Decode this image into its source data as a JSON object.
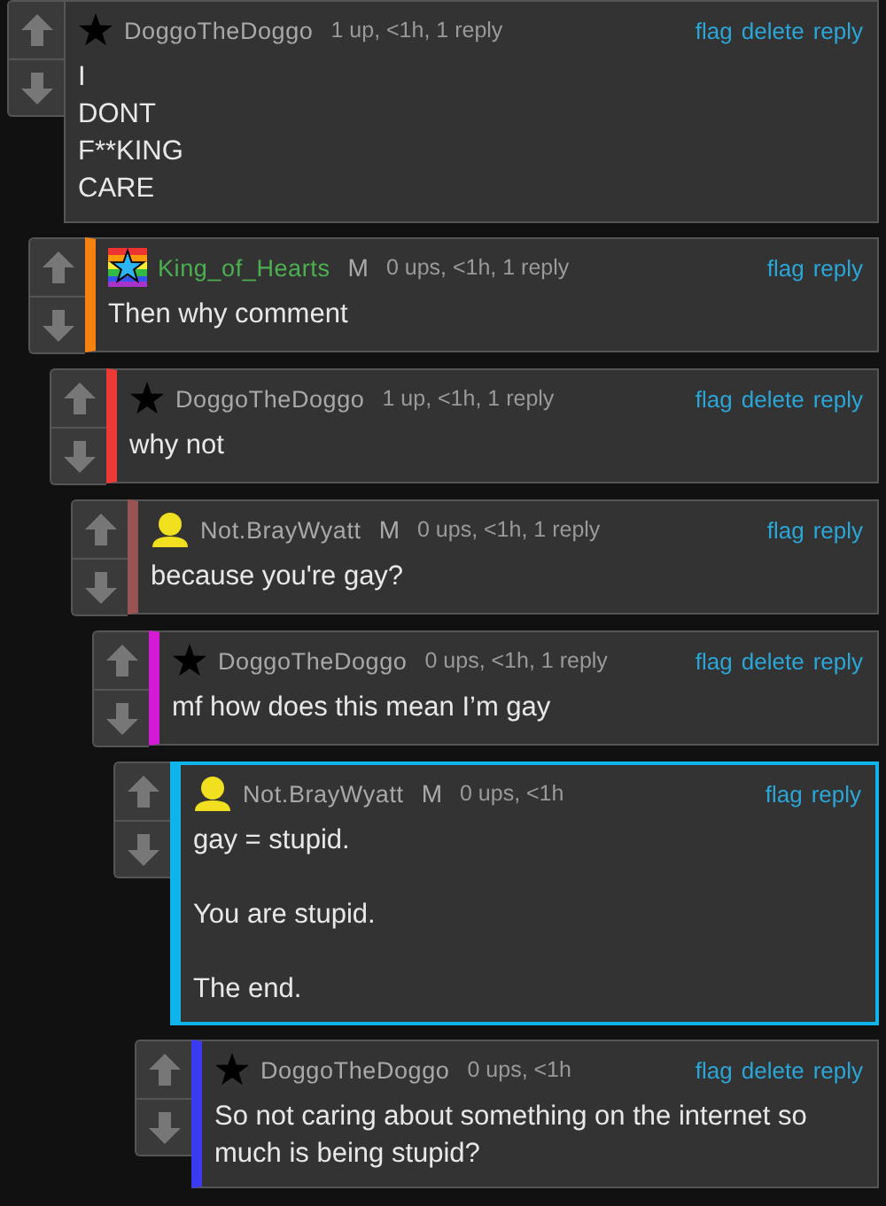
{
  "thread": {
    "author": {
      "name": "DoggoTheDoggo",
      "color": "#a8a8a8"
    },
    "avatar": {
      "kind": "star"
    },
    "meta": "1 up, <1h, 1 reply",
    "actions": [
      "flag",
      "delete",
      "reply"
    ],
    "text": "I\nDONT\nF**KING\nCARE",
    "highlighted": false,
    "children": [
      {
        "author": {
          "name": "King_of_Hearts",
          "color": "#4caf50"
        },
        "avatar": {
          "kind": "rainbow_star"
        },
        "badge": "M",
        "meta": "0 ups, <1h, 1 reply",
        "actions": [
          "flag",
          "reply"
        ],
        "text": "Then why comment",
        "color": "#f7820f",
        "highlighted": false,
        "children": [
          {
            "author": {
              "name": "DoggoTheDoggo",
              "color": "#a8a8a8"
            },
            "avatar": {
              "kind": "star"
            },
            "meta": "1 up, <1h, 1 reply",
            "actions": [
              "flag",
              "delete",
              "reply"
            ],
            "text": "why not",
            "color": "#ee3a36",
            "highlighted": false,
            "children": [
              {
                "author": {
                  "name": "Not.BrayWyatt",
                  "color": "#a8a8a8"
                },
                "avatar": {
                  "kind": "person"
                },
                "badge": "M",
                "meta": "0 ups, <1h, 1 reply",
                "actions": [
                  "flag",
                  "reply"
                ],
                "text": "because you're gay?",
                "color": "#9a5353",
                "highlighted": false,
                "children": [
                  {
                    "author": {
                      "name": "DoggoTheDoggo",
                      "color": "#a8a8a8"
                    },
                    "avatar": {
                      "kind": "star"
                    },
                    "meta": "0 ups, <1h, 1 reply",
                    "actions": [
                      "flag",
                      "delete",
                      "reply"
                    ],
                    "text": "mf how does this mean I’m gay",
                    "color": "#d41ad4",
                    "highlighted": false,
                    "children": [
                      {
                        "author": {
                          "name": "Not.BrayWyatt",
                          "color": "#a8a8a8"
                        },
                        "avatar": {
                          "kind": "person"
                        },
                        "badge": "M",
                        "meta": "0 ups, <1h",
                        "actions": [
                          "flag",
                          "reply"
                        ],
                        "text": "gay = stupid.\n\nYou are stupid.\n\nThe end.",
                        "color": "#10b4ec",
                        "highlighted": true,
                        "children": [
                          {
                            "author": {
                              "name": "DoggoTheDoggo",
                              "color": "#a8a8a8"
                            },
                            "avatar": {
                              "kind": "star"
                            },
                            "meta": "0 ups, <1h",
                            "actions": [
                              "flag",
                              "delete",
                              "reply"
                            ],
                            "text": "So not caring about something on the internet so much is being stupid?",
                            "color": "#3a3af0",
                            "highlighted": false
                          }
                        ]
                      }
                    ]
                  }
                ]
              }
            ]
          }
        ]
      }
    ]
  }
}
